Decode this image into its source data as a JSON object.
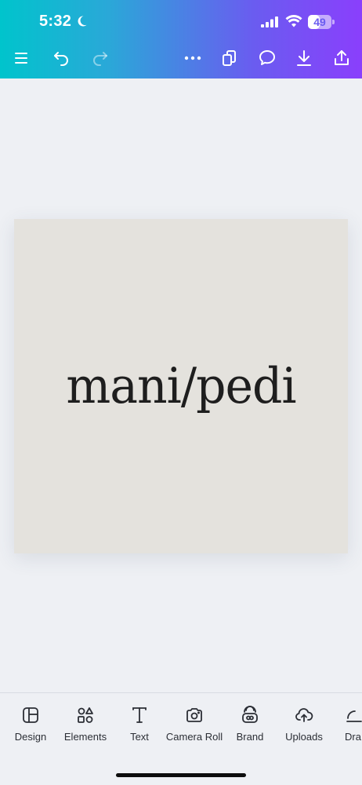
{
  "status_bar": {
    "time": "5:32",
    "battery": "49",
    "battery_level": 0.49
  },
  "toolbar": {
    "icons": [
      "menu-icon",
      "undo-icon",
      "redo-icon",
      "more-icon",
      "pages-icon",
      "comment-icon",
      "download-icon",
      "share-icon"
    ]
  },
  "canvas": {
    "text": "mani/pedi",
    "background": "#e4e2dd"
  },
  "bottom_nav": {
    "items": [
      {
        "label": "Design",
        "icon": "design-icon"
      },
      {
        "label": "Elements",
        "icon": "elements-icon"
      },
      {
        "label": "Text",
        "icon": "text-icon"
      },
      {
        "label": "Camera Roll",
        "icon": "camera-icon"
      },
      {
        "label": "Brand",
        "icon": "brand-icon"
      },
      {
        "label": "Uploads",
        "icon": "upload-cloud-icon"
      },
      {
        "label": "Dra",
        "icon": "draw-icon"
      }
    ]
  },
  "colors": {
    "gradient_start": "#00c4cc",
    "gradient_end": "#8a3ffc"
  }
}
